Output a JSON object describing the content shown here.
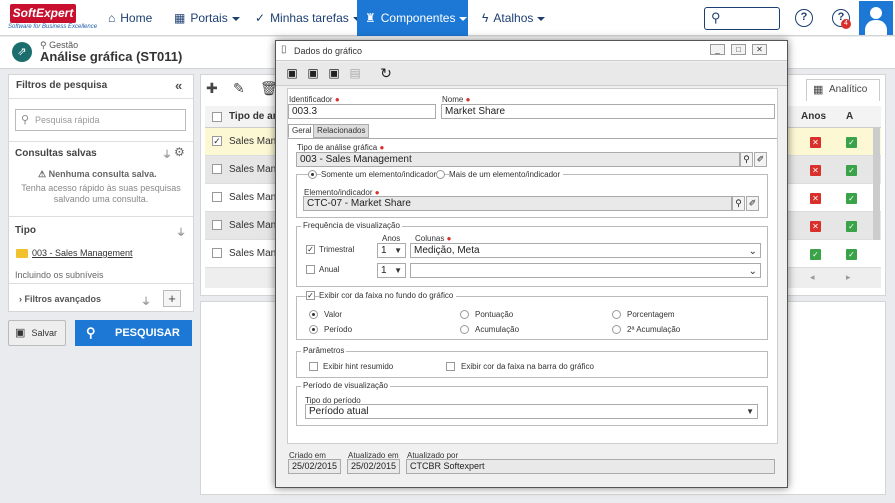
{
  "app": {
    "logo_text": "SoftExpert",
    "logo_tagline": "Software for Business Excellence"
  },
  "nav": {
    "items": [
      {
        "label": "Home"
      },
      {
        "label": "Portais"
      },
      {
        "label": "Minhas tarefas"
      },
      {
        "label": "Componentes"
      },
      {
        "label": "Atalhos"
      }
    ],
    "notification_count": "4",
    "help_icon": "question-circle-icon"
  },
  "page": {
    "breadcrumb": "Gestão",
    "title": "Análise gráfica (ST011)"
  },
  "left_panel": {
    "filters_title": "Filtros de pesquisa",
    "quick_search_placeholder": "Pesquisa rápida",
    "saved_title": "Consultas salvas",
    "no_saved": "Nenhuma consulta salva.",
    "saved_hint": "Tenha acesso rápido às suas pesquisas salvando uma consulta.",
    "type_title": "Tipo",
    "type_item": "003 - Sales Management",
    "include_sub": "Incluindo os subníveis",
    "advanced": "Filtros avançados",
    "save_label": "Salvar",
    "search_label": "PESQUISAR"
  },
  "grid": {
    "col_type": "Tipo de aná",
    "col_years": "Anos",
    "col_a": "A",
    "analytic_tab": "Analítico",
    "rows": [
      {
        "type": "Sales Mana",
        "years": "x",
        "a": "ok",
        "checked": true
      },
      {
        "type": "Sales Mana",
        "years": "x",
        "a": "ok",
        "checked": false
      },
      {
        "type": "Sales Mana",
        "years": "x",
        "a": "ok",
        "checked": false
      },
      {
        "type": "Sales Mana",
        "years": "x",
        "a": "ok",
        "checked": false
      },
      {
        "type": "Sales Mana",
        "years": "ok",
        "a": "ok",
        "checked": false
      }
    ]
  },
  "modal": {
    "title": "Dados do gráfico",
    "id_label": "Identificador",
    "id_value": "003.3",
    "name_label": "Nome",
    "name_value": "Market Share",
    "tab_general": "Geral",
    "tab_related": "Relacionados",
    "analysis_type_label": "Tipo de análise gráfica",
    "analysis_type_value": "003 - Sales Management",
    "opt_single": "Somente um elemento/indicador",
    "opt_multi": "Mais de um elemento/indicador",
    "element_label": "Elemento/indicador",
    "element_value": "CTC-07 - Market Share",
    "freq_legend": "Frequência de visualização",
    "years_label": "Anos",
    "columns_label": "Colunas",
    "quarterly_label": "Trimestral",
    "quarterly_years": "1",
    "quarterly_columns": "Medição, Meta",
    "annual_label": "Anual",
    "annual_years": "1",
    "annual_columns": "",
    "band_legend": "Exibir cor da faixa no fundo do gráfico",
    "band_opts": [
      "Valor",
      "Pontuação",
      "Porcentagem",
      "Período",
      "Acumulação",
      "2ª Acumulação"
    ],
    "params_legend": "Parâmetros",
    "param_hint": "Exibir hint resumido",
    "param_bar": "Exibir cor da faixa na barra do gráfico",
    "period_legend": "Período de visualização",
    "period_type_label": "Tipo do período",
    "period_type_value": "Período atual",
    "created_label": "Criado em",
    "created_value": "25/02/2015",
    "updated_label": "Atualizado em",
    "updated_value": "25/02/2015",
    "updated_by_label": "Atualizado por",
    "updated_by_value": "CTCBR Softexpert"
  }
}
